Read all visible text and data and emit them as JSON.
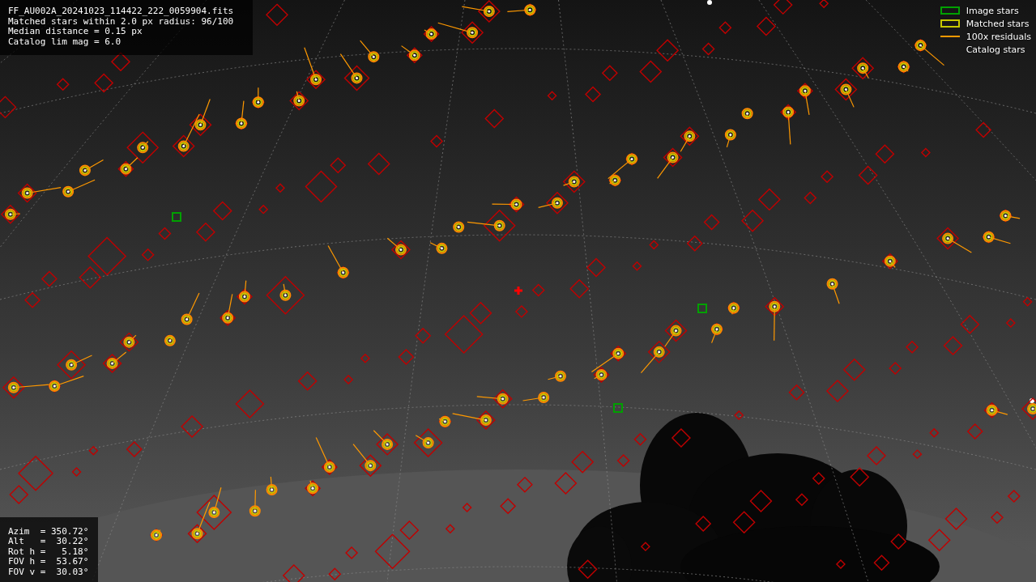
{
  "header": {
    "lines": [
      "FF_AU002A_20241023_114422_222_0059904.fits",
      "Matched stars within 2.0 px radius: 96/100",
      "Median distance = 0.15 px",
      "Catalog lim mag = 6.0"
    ]
  },
  "legend": [
    {
      "label": "Image stars",
      "kind": "box",
      "color": "#00a000"
    },
    {
      "label": "Matched stars",
      "kind": "box",
      "color": "#c8c800"
    },
    {
      "label": "100x residuals",
      "kind": "line",
      "color": "#ff9900"
    },
    {
      "label": "Catalog stars",
      "kind": "none"
    }
  ],
  "pointing": {
    "lines": [
      "Azim  = 350.72°",
      "Alt   =  30.22°",
      "Rot h =   5.18°",
      "FOV h =  53.67°",
      "FOV v =  30.03°"
    ]
  }
}
